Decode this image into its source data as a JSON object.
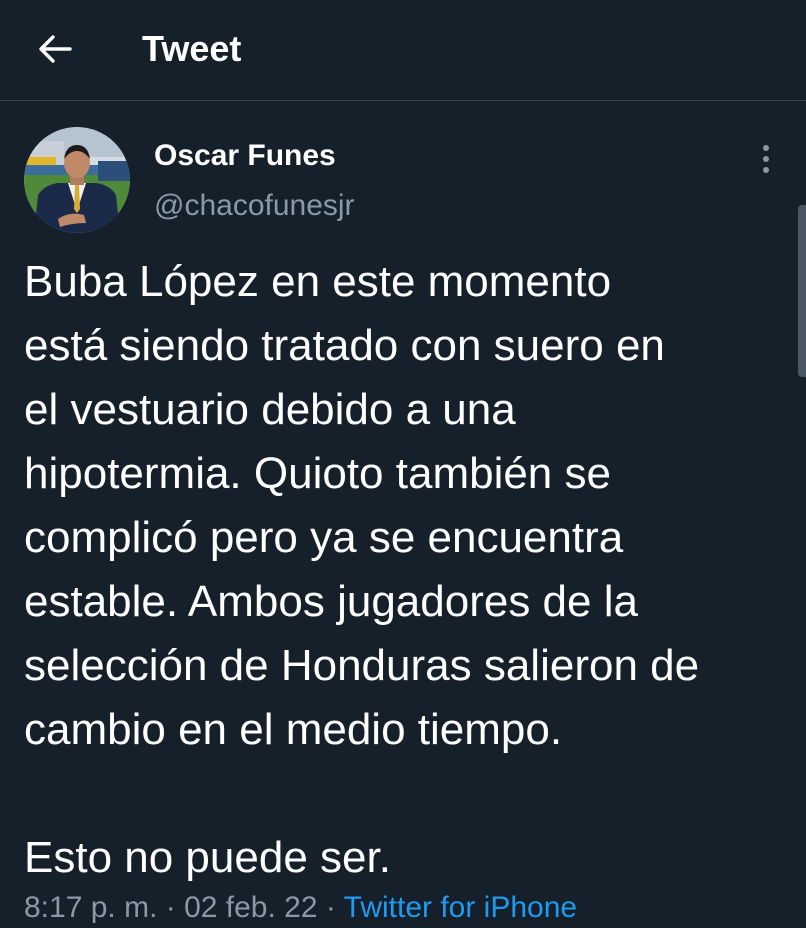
{
  "header": {
    "title": "Tweet",
    "back_icon": "arrow-left-icon"
  },
  "tweet": {
    "author_name": "Oscar Funes",
    "author_handle": "@chacofunesjr",
    "more_icon": "vertical-ellipsis-icon",
    "text_lines": [
      "Buba López en este momento",
      "está siendo tratado con suero en",
      "el vestuario debido a una",
      "hipotermia. Quioto también se",
      "complicó pero ya se encuentra",
      "estable. Ambos jugadores de la",
      "selección de Honduras salieron de",
      "cambio en el medio tiempo."
    ],
    "text_closing": "Esto no puede ser.",
    "time": "8:17 p. m.",
    "date": "02 feb. 22",
    "separator": " · ",
    "source": "Twitter for iPhone"
  },
  "colors": {
    "background": "#15202b",
    "secondary_text": "#8b98a5",
    "link": "#1d9bf0",
    "divider": "#38444d"
  }
}
